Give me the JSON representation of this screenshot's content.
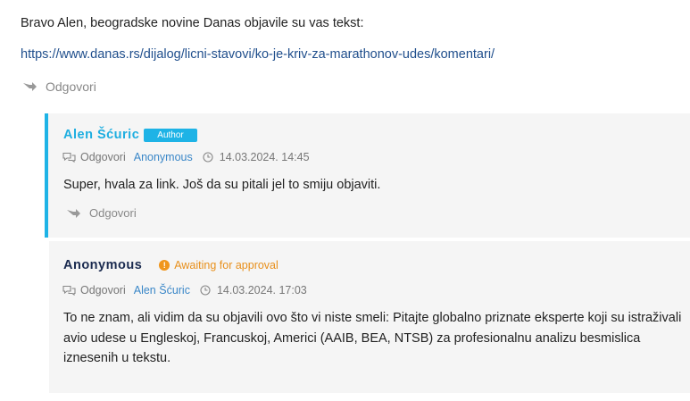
{
  "top": {
    "text": "Bravo Alen, beogradske novine Danas objavile su vas tekst:",
    "link": "https://www.danas.rs/dijalog/licni-stavovi/ko-je-kriv-za-marathonov-udes/komentari/",
    "reply_label": "Odgovori"
  },
  "comment1": {
    "author": "Alen Šćuric",
    "badge": "Author",
    "meta_reply": "Odgovori",
    "reply_to": "Anonymous",
    "timestamp": "14.03.2024. 14:45",
    "text": "Super, hvala za link. Još da su pitali jel to smiju objaviti.",
    "reply_label": "Odgovori"
  },
  "comment2": {
    "author": "Anonymous",
    "status": "Awaiting for approval",
    "meta_reply": "Odgovori",
    "reply_to": "Alen Šćuric",
    "timestamp": "14.03.2024. 17:03",
    "text": "To ne znam, ali vidim da su objavili ovo što vi niste smeli: Pitajte globalno priznate eksperte koji su istraživali avio udese u Engleskoj, Francuskoj, Americi (AAIB, BEA, NTSB) za profesionalnu analizu besmislica iznesenih u tekstu."
  },
  "colors": {
    "accent": "#1eb3e6",
    "link": "#1f4e8c",
    "warning": "#f0961c",
    "card_bg": "#f5f5f5"
  }
}
